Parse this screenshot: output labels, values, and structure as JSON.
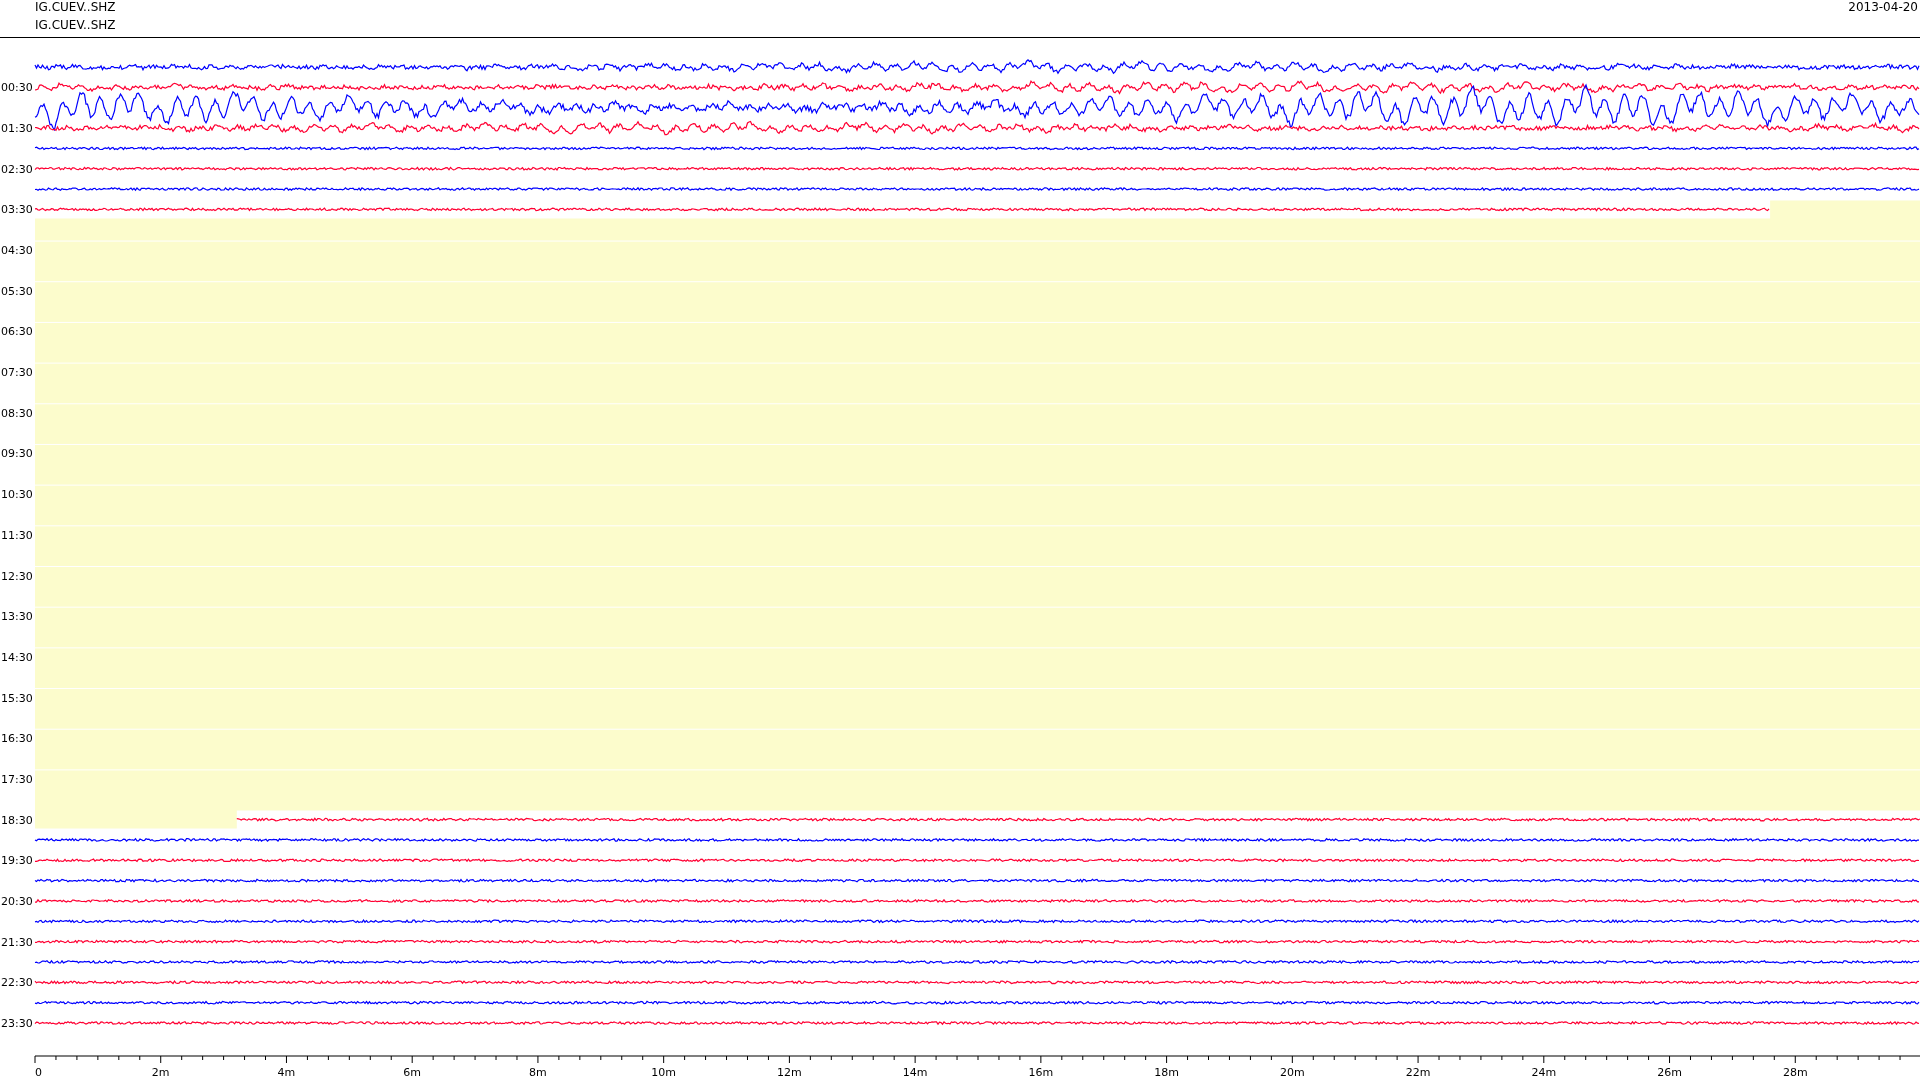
{
  "header": {
    "channels": [
      "IG.CUEV..SHZ",
      "IG.CUEV..SHZ"
    ],
    "date": "2013-04-20"
  },
  "time_labels": [
    "00:30",
    "01:30",
    "02:30",
    "03:30",
    "04:30",
    "05:30",
    "06:30",
    "07:30",
    "08:30",
    "09:30",
    "10:30",
    "11:30",
    "12:30",
    "13:30",
    "14:30",
    "15:30",
    "16:30",
    "17:30",
    "18:30",
    "19:30",
    "20:30",
    "21:30",
    "22:30",
    "23:30"
  ],
  "traces": [
    {
      "color": "#0000ff",
      "kind": "active"
    },
    {
      "color": "#ff0033",
      "kind": "active"
    },
    {
      "color": "#0000ff",
      "kind": "strong"
    },
    {
      "color": "#ff0033",
      "kind": "active"
    },
    {
      "color": "#0000ff",
      "kind": "quiet"
    },
    {
      "color": "#ff0033",
      "kind": "quiet"
    },
    {
      "color": "#0000ff",
      "kind": "quiet"
    },
    {
      "color": "#ff0033",
      "kind": "truncated"
    },
    {
      "kind": "gap"
    },
    {
      "kind": "gap"
    },
    {
      "kind": "gap"
    },
    {
      "kind": "gap"
    },
    {
      "kind": "gap"
    },
    {
      "kind": "gap"
    },
    {
      "kind": "gap"
    },
    {
      "kind": "gap"
    },
    {
      "kind": "gap"
    },
    {
      "kind": "gap"
    },
    {
      "kind": "gap"
    },
    {
      "kind": "gap"
    },
    {
      "kind": "gap"
    },
    {
      "kind": "gap"
    },
    {
      "kind": "gap"
    },
    {
      "kind": "gap"
    },
    {
      "kind": "gap"
    },
    {
      "kind": "gap"
    },
    {
      "kind": "gap"
    },
    {
      "kind": "gap"
    },
    {
      "kind": "gap"
    },
    {
      "kind": "gap"
    },
    {
      "kind": "gap"
    },
    {
      "kind": "gap"
    },
    {
      "kind": "gap"
    },
    {
      "kind": "gap"
    },
    {
      "kind": "gap"
    },
    {
      "kind": "gap"
    },
    {
      "kind": "gap"
    },
    {
      "color": "#ff0033",
      "kind": "delayed"
    },
    {
      "color": "#0000ff",
      "kind": "quiet"
    },
    {
      "color": "#ff0033",
      "kind": "quiet"
    },
    {
      "color": "#0000ff",
      "kind": "quiet"
    },
    {
      "color": "#ff0033",
      "kind": "quiet"
    },
    {
      "color": "#0000ff",
      "kind": "quiet"
    },
    {
      "color": "#ff0033",
      "kind": "quiet"
    },
    {
      "color": "#0000ff",
      "kind": "quiet"
    },
    {
      "color": "#ff0033",
      "kind": "quiet"
    },
    {
      "color": "#0000ff",
      "kind": "quiet"
    },
    {
      "color": "#ff0033",
      "kind": "quiet"
    }
  ],
  "x_axis": {
    "ticks": [
      "0",
      "2m",
      "4m",
      "6m",
      "8m",
      "10m",
      "12m",
      "14m",
      "16m",
      "18m",
      "20m",
      "22m",
      "24m",
      "26m",
      "28m"
    ]
  }
}
